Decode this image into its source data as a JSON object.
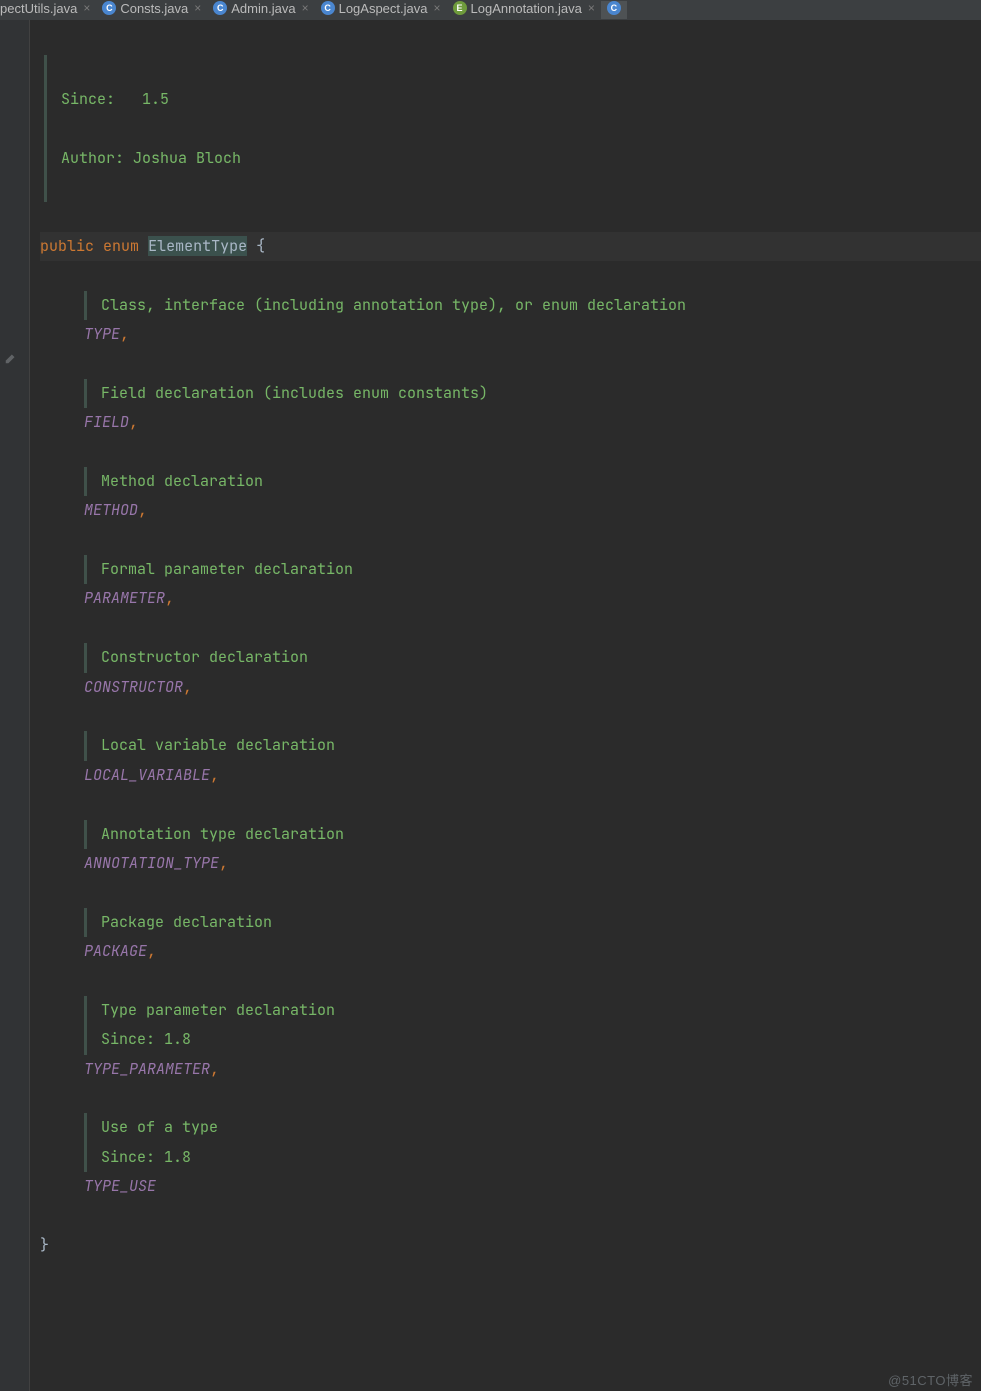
{
  "tabs": [
    {
      "label": "pectUtils.java",
      "iconLetter": "",
      "iconClass": "",
      "partialLeft": true
    },
    {
      "label": "Consts.java",
      "iconLetter": "C",
      "iconClass": "icon-java"
    },
    {
      "label": "Admin.java",
      "iconLetter": "C",
      "iconClass": "icon-java"
    },
    {
      "label": "LogAspect.java",
      "iconLetter": "C",
      "iconClass": "icon-java"
    },
    {
      "label": "LogAnnotation.java",
      "iconLetter": "E",
      "iconClass": "icon-enum"
    }
  ],
  "header": {
    "sinceLabel": "Since:",
    "sinceValue": "1.5",
    "authorLabel": "Author:",
    "authorValue": "Joshua Bloch"
  },
  "decl": {
    "kwPublic": "public",
    "kwEnum": "enum",
    "typeName": "ElementType",
    "openBrace": "{",
    "closeBrace": "}"
  },
  "entries": [
    {
      "doc": [
        "Class, interface (including annotation type), or enum declaration"
      ],
      "name": "TYPE",
      "trailingComma": true
    },
    {
      "doc": [
        "Field declaration (includes enum constants)"
      ],
      "name": "FIELD",
      "trailingComma": true
    },
    {
      "doc": [
        "Method declaration"
      ],
      "name": "METHOD",
      "trailingComma": true
    },
    {
      "doc": [
        "Formal parameter declaration"
      ],
      "name": "PARAMETER",
      "trailingComma": true
    },
    {
      "doc": [
        "Constructor declaration"
      ],
      "name": "CONSTRUCTOR",
      "trailingComma": true
    },
    {
      "doc": [
        "Local variable declaration"
      ],
      "name": "LOCAL_VARIABLE",
      "trailingComma": true
    },
    {
      "doc": [
        "Annotation type declaration"
      ],
      "name": "ANNOTATION_TYPE",
      "trailingComma": true
    },
    {
      "doc": [
        "Package declaration"
      ],
      "name": "PACKAGE",
      "trailingComma": true
    },
    {
      "doc": [
        "Type parameter declaration",
        "Since: 1.8"
      ],
      "name": "TYPE_PARAMETER",
      "trailingComma": true
    },
    {
      "doc": [
        "Use of a type",
        "Since: 1.8"
      ],
      "name": "TYPE_USE",
      "trailingComma": false
    }
  ],
  "watermark": "@51CTO博客"
}
